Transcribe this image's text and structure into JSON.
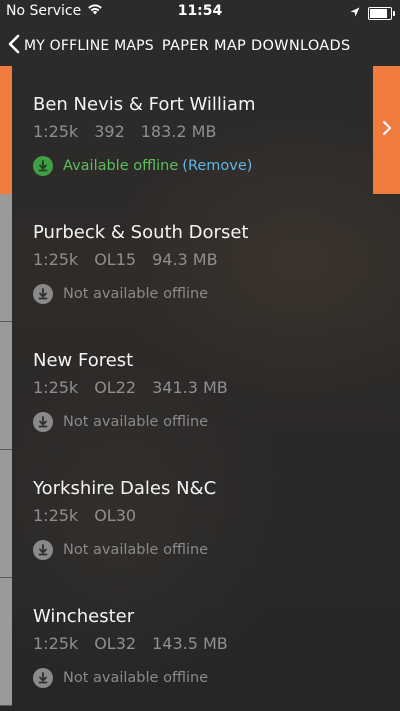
{
  "status_bar": {
    "carrier": "No Service",
    "time": "11:54",
    "battery_level": 0.85
  },
  "nav": {
    "back_label": "MY OFFLINE MAPS",
    "title": "PAPER MAP DOWNLOADS"
  },
  "colors": {
    "accent": "#f07b3f",
    "available": "#5cbf5c",
    "link": "#5fb7e5",
    "unavailable": "#8a8a8a"
  },
  "maps": [
    {
      "name": "Ben Nevis & Fort William",
      "scale": "1:25k",
      "code": "392",
      "size": "183.2 MB",
      "status": "Available offline",
      "remove_label": "(Remove)"
    },
    {
      "name": "Purbeck & South Dorset",
      "scale": "1:25k",
      "code": "OL15",
      "size": "94.3 MB",
      "status": "Not available offline"
    },
    {
      "name": "New Forest",
      "scale": "1:25k",
      "code": "OL22",
      "size": "341.3 MB",
      "status": "Not available offline"
    },
    {
      "name": "Yorkshire Dales N&C",
      "scale": "1:25k",
      "code": "OL30",
      "size": "",
      "status": "Not available offline"
    },
    {
      "name": "Winchester",
      "scale": "1:25k",
      "code": "OL32",
      "size": "143.5 MB",
      "status": "Not available offline"
    }
  ]
}
